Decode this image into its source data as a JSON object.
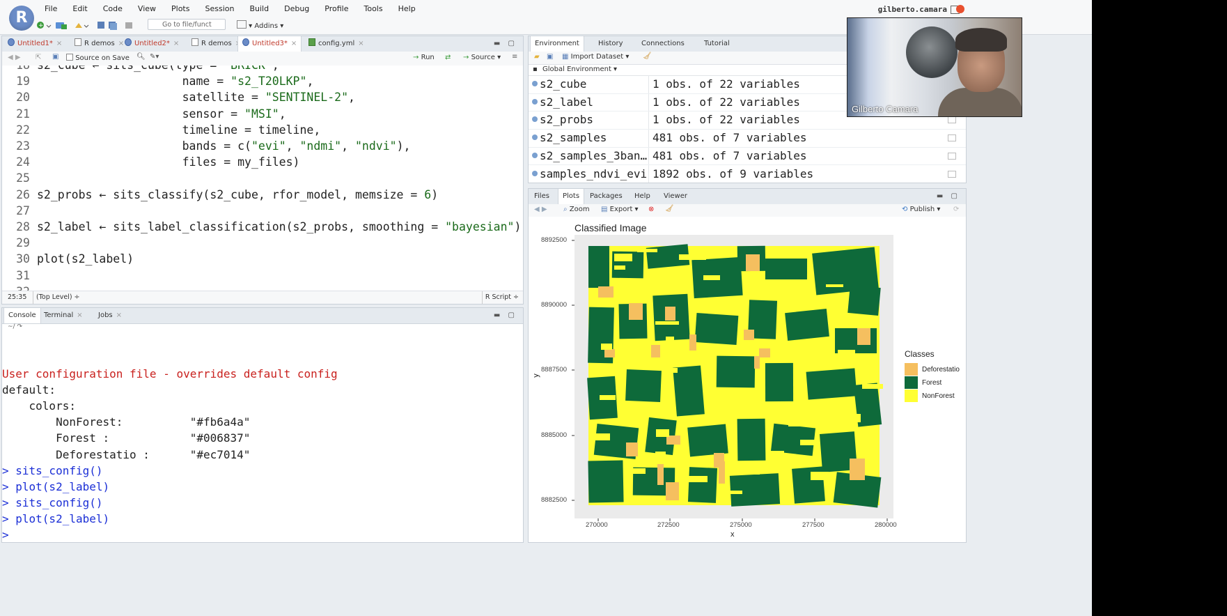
{
  "menu": [
    "File",
    "Edit",
    "Code",
    "View",
    "Plots",
    "Session",
    "Build",
    "Debug",
    "Profile",
    "Tools",
    "Help"
  ],
  "user": "gilberto.camara",
  "toolbar": {
    "goto_placeholder": "Go to file/funct",
    "addins": "Addins"
  },
  "editor": {
    "tabs": [
      {
        "label": "Untitled1*",
        "modified": true
      },
      {
        "label": "R demos",
        "modified": false
      },
      {
        "label": "Untitled2*",
        "modified": true
      },
      {
        "label": "R demos",
        "modified": false
      },
      {
        "label": "Untitled3*",
        "modified": true,
        "active": true
      },
      {
        "label": "config.yml",
        "modified": false
      }
    ],
    "source_on_save": "Source on Save",
    "run": "Run",
    "source": "Source",
    "line_numbers": [
      "18",
      "19",
      "20",
      "21",
      "22",
      "23",
      "24",
      "25",
      "26",
      "27",
      "28",
      "29",
      "30",
      "31",
      "32"
    ],
    "status_pos": "25:35",
    "status_scope": "(Top Level) ÷",
    "status_type": "R Script ÷"
  },
  "console": {
    "tabs": [
      "Console",
      "Terminal",
      "Jobs"
    ],
    "path": "~/",
    "lines": [
      {
        "text": "",
        "cls": ""
      },
      {
        "text": "User configuration file - overrides default config",
        "cls": "red"
      },
      {
        "text": "default:",
        "cls": ""
      },
      {
        "text": "    colors:",
        "cls": ""
      },
      {
        "text": "        NonForest:          \"#fb6a4a\"",
        "cls": ""
      },
      {
        "text": "        Forest :            \"#006837\"",
        "cls": ""
      },
      {
        "text": "        Deforestatio :      \"#ec7014\"",
        "cls": ""
      },
      {
        "text": "> sits_config()",
        "cls": "blue"
      },
      {
        "text": "> plot(s2_label)",
        "cls": "blue"
      },
      {
        "text": "> sits_config()",
        "cls": "blue"
      },
      {
        "text": "> plot(s2_label)",
        "cls": "blue"
      },
      {
        "text": "> ",
        "cls": "blue"
      }
    ]
  },
  "environment": {
    "tabs": [
      "Environment",
      "History",
      "Connections",
      "Tutorial"
    ],
    "import_label": "Import Dataset",
    "scope": "Global Environment",
    "rows": [
      {
        "name": "s2_cube",
        "value": "1 obs. of 22 variables"
      },
      {
        "name": "s2_label",
        "value": "1 obs. of 22 variables"
      },
      {
        "name": "s2_probs",
        "value": "1 obs. of 22 variables"
      },
      {
        "name": "s2_samples",
        "value": "481 obs. of 7 variables"
      },
      {
        "name": "s2_samples_3ban…",
        "value": "481 obs. of 7 variables"
      },
      {
        "name": "samples_ndvi_evi",
        "value": "1892 obs. of 9 variables"
      }
    ]
  },
  "files": {
    "tabs": [
      "Files",
      "Plots",
      "Packages",
      "Help",
      "Viewer"
    ],
    "zoom": "Zoom",
    "export": "Export",
    "publish": "Publish"
  },
  "chart_data": {
    "type": "heatmap",
    "title": "Classified Image",
    "xlabel": "x",
    "ylabel": "y",
    "x_ticks": [
      "270000",
      "272500",
      "275000",
      "277500",
      "280000"
    ],
    "y_ticks": [
      "8892500",
      "8890000",
      "8887500",
      "8885000",
      "8882500"
    ],
    "legend_title": "Classes",
    "legend": [
      {
        "name": "Deforestatio",
        "color": "#f5bf5f"
      },
      {
        "name": "Forest",
        "color": "#0e6a3a"
      },
      {
        "name": "NonForest",
        "color": "#ffff33"
      }
    ]
  },
  "webcam": {
    "name": "Gilberto Camara"
  }
}
